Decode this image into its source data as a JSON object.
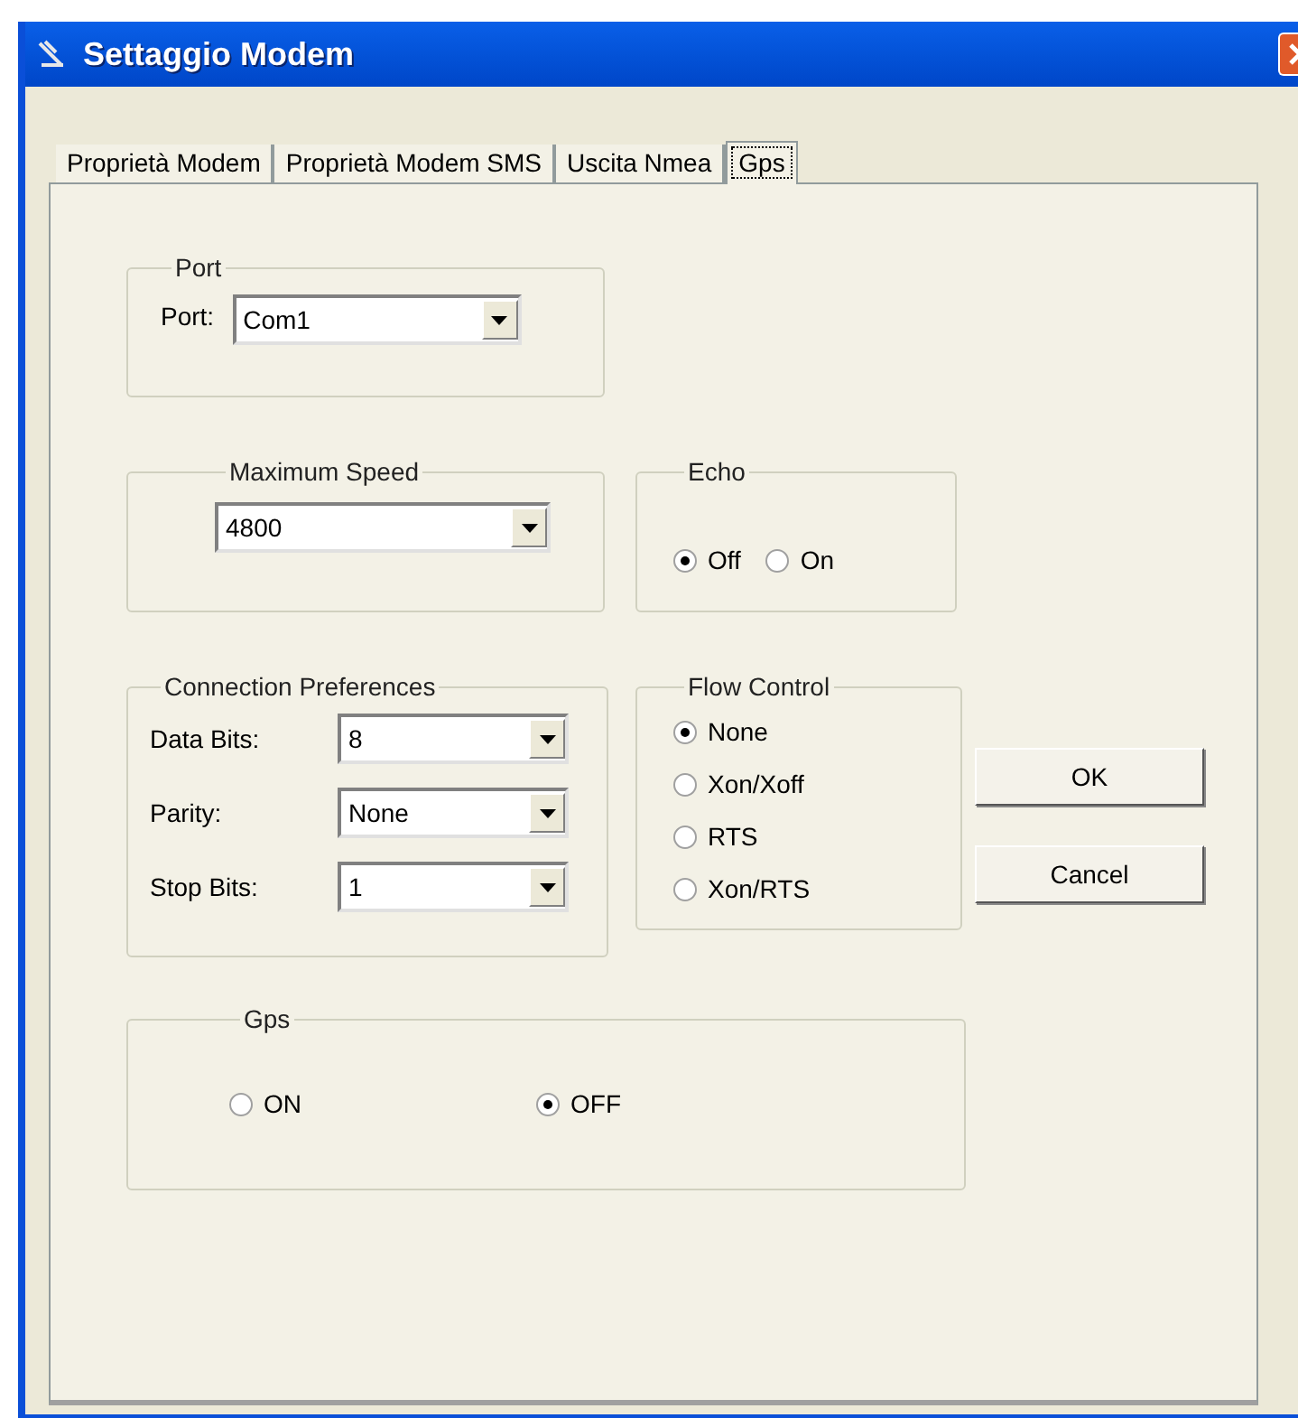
{
  "window": {
    "title": "Settaggio Modem"
  },
  "tabs": [
    {
      "label": "Proprietà Modem",
      "selected": false
    },
    {
      "label": "Proprietà Modem SMS",
      "selected": false
    },
    {
      "label": "Uscita Nmea",
      "selected": false
    },
    {
      "label": "Gps",
      "selected": true
    }
  ],
  "port": {
    "title": "Port",
    "label": "Port:",
    "value": "Com1"
  },
  "maximum_speed": {
    "title": "Maximum Speed",
    "value": "4800"
  },
  "echo": {
    "title": "Echo",
    "options": [
      {
        "label": "Off",
        "selected": true
      },
      {
        "label": "On",
        "selected": false
      }
    ]
  },
  "connection_preferences": {
    "title": "Connection Preferences",
    "fields": [
      {
        "label": "Data Bits:",
        "value": "8"
      },
      {
        "label": "Parity:",
        "value": "None"
      },
      {
        "label": "Stop Bits:",
        "value": "1"
      }
    ]
  },
  "flow_control": {
    "title": "Flow Control",
    "options": [
      {
        "label": "None",
        "selected": true
      },
      {
        "label": "Xon/Xoff",
        "selected": false
      },
      {
        "label": "RTS",
        "selected": false
      },
      {
        "label": "Xon/RTS",
        "selected": false
      }
    ]
  },
  "buttons": [
    "OK",
    "Cancel"
  ],
  "gps": {
    "title": "Gps",
    "options": [
      {
        "label": "ON",
        "selected": false
      },
      {
        "label": "OFF",
        "selected": true
      }
    ]
  }
}
